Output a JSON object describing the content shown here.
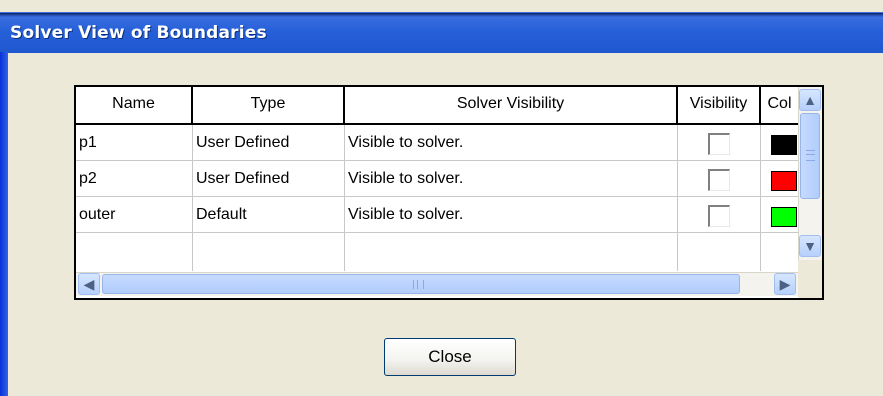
{
  "window": {
    "title": "Solver View of Boundaries"
  },
  "table": {
    "columns": [
      "Name",
      "Type",
      "Solver Visibility",
      "Visibility",
      "Col"
    ],
    "rows": [
      {
        "name": "p1",
        "type": "User Defined",
        "solver_visibility": "Visible to solver.",
        "visible": false,
        "color": "#000000",
        "color_name": "black"
      },
      {
        "name": "p2",
        "type": "User Defined",
        "solver_visibility": "Visible to solver.",
        "visible": false,
        "color": "#ff0000",
        "color_name": "red"
      },
      {
        "name": "outer",
        "type": "Default",
        "solver_visibility": "Visible to solver.",
        "visible": false,
        "color": "#00ff00",
        "color_name": "green"
      }
    ]
  },
  "scrollbars": {
    "vertical_up_icon": "chevron-up-icon",
    "vertical_down_icon": "chevron-down-icon",
    "horizontal_left_icon": "chevron-left-icon",
    "horizontal_right_icon": "chevron-right-icon"
  },
  "buttons": {
    "close_label": "Close"
  },
  "colors": {
    "title_bar": "#2660d8",
    "dialog_face": "#ece9d8"
  }
}
